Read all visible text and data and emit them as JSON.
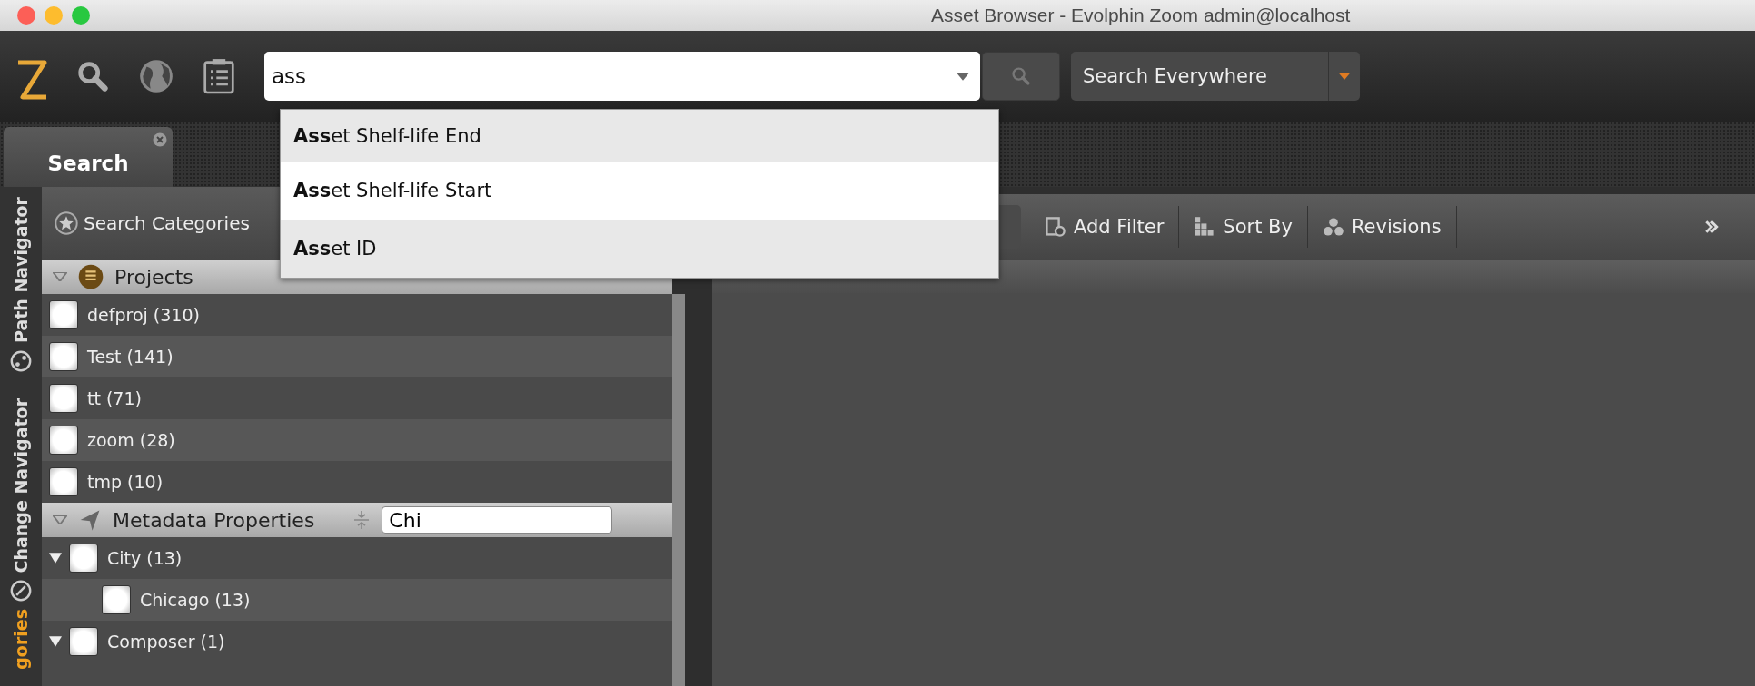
{
  "window": {
    "title": "Asset Browser - Evolphin Zoom admin@localhost"
  },
  "toolbar": {
    "search": {
      "value": "ass"
    },
    "scope": "Search Everywhere"
  },
  "suggestions": [
    {
      "label": "**Ass**et Shelf-life End"
    },
    {
      "label": "**Ass**et Shelf-life Start"
    },
    {
      "label": "**Ass**et ID"
    }
  ],
  "tabs": [
    {
      "label": "Search",
      "selected": true
    }
  ],
  "side_tabs": [
    {
      "label": "Path Navigator",
      "selected": false,
      "kind": "path"
    },
    {
      "label": "Change Navigator",
      "selected": false,
      "kind": "change"
    },
    {
      "label": "gories",
      "selected": true,
      "kind": "categories"
    }
  ],
  "categories": {
    "title": "Search Categories",
    "sections": [
      {
        "title": "Projects",
        "kind": "projects",
        "items": [
          {
            "label": "defproj (310)",
            "checked": false
          },
          {
            "label": "Test (141)",
            "checked": false
          },
          {
            "label": "tt (71)",
            "checked": false
          },
          {
            "label": "zoom (28)",
            "checked": false
          },
          {
            "label": "tmp (10)",
            "checked": false
          }
        ]
      },
      {
        "title": "Metadata Properties",
        "kind": "metadata",
        "filter": "Chi",
        "items": [
          {
            "label": "City (13)",
            "checked": false,
            "expanded": true,
            "children": [
              {
                "label": "Chicago (13)",
                "checked": false
              }
            ]
          },
          {
            "label": "Composer (1)",
            "checked": false,
            "expanded": true
          }
        ]
      }
    ]
  },
  "results_toolbar": [
    {
      "label": "Add Filter",
      "kind": "filter"
    },
    {
      "label": "Sort By",
      "kind": "sort"
    },
    {
      "label": "Revisions",
      "kind": "revisions"
    }
  ]
}
